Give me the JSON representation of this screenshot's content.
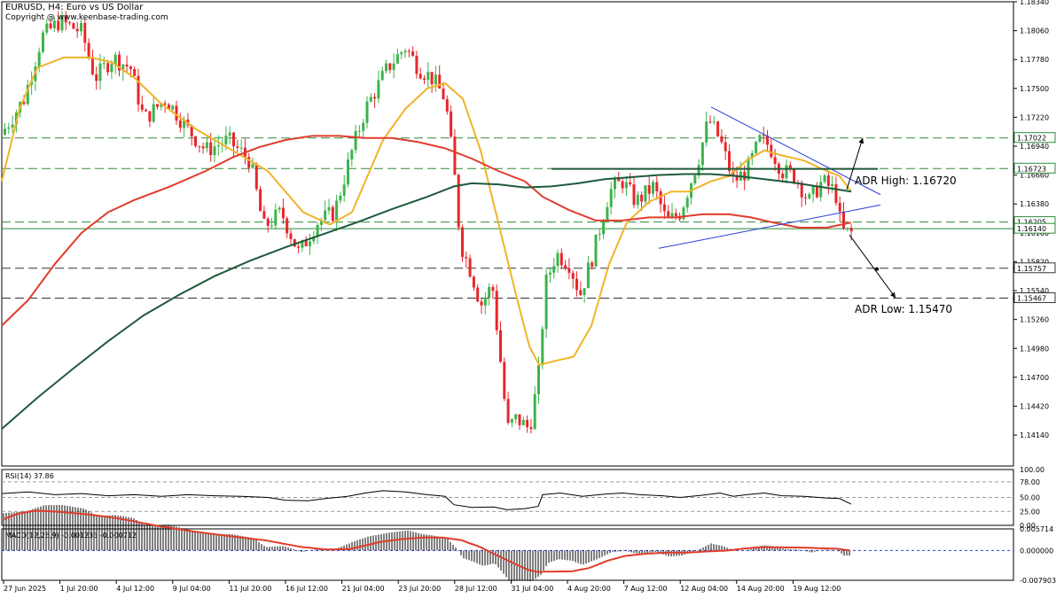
{
  "header": {
    "symbol_line": "EURUSD, H4:  Euro vs US Dollar",
    "copyright": "Copyright @ www.keenbase-trading.com"
  },
  "annotations": {
    "adr_high": "ADR High:  1.16720",
    "adr_low": "ADR Low:  1.15470"
  },
  "chart_data": [
    {
      "type": "candlestick",
      "title": "EURUSD, H4:  Euro vs US Dollar",
      "ylim": [
        1.1384,
        1.1834
      ],
      "y_ticks": [
        "1.18340",
        "1.18060",
        "1.17780",
        "1.17500",
        "1.17220",
        "1.16940",
        "1.16660",
        "1.16380",
        "1.16100",
        "1.15820",
        "1.15540",
        "1.15260",
        "1.14980",
        "1.14700",
        "1.14420",
        "1.14140"
      ],
      "x_ticks": [
        "27 Jun 2025",
        "1 Jul 20:00",
        "4 Jul 12:00",
        "9 Jul 04:00",
        "11 Jul 20:00",
        "16 Jul 12:00",
        "21 Jul 04:00",
        "23 Jul 20:00",
        "28 Jul 12:00",
        "31 Jul 04:00",
        "4 Aug 20:00",
        "7 Aug 12:00",
        "12 Aug 04:00",
        "14 Aug 20:00",
        "19 Aug 12:00"
      ],
      "price_path": [
        [
          0,
          1.17
        ],
        [
          30,
          1.174
        ],
        [
          50,
          1.18
        ],
        [
          70,
          1.1815
        ],
        [
          95,
          1.1805
        ],
        [
          110,
          1.176
        ],
        [
          130,
          1.178
        ],
        [
          150,
          1.177
        ],
        [
          165,
          1.172
        ],
        [
          190,
          1.174
        ],
        [
          215,
          1.171
        ],
        [
          235,
          1.169
        ],
        [
          260,
          1.17
        ],
        [
          285,
          1.168
        ],
        [
          300,
          1.1615
        ],
        [
          320,
          1.163
        ],
        [
          340,
          1.159
        ],
        [
          360,
          1.162
        ],
        [
          380,
          1.163
        ],
        [
          400,
          1.169
        ],
        [
          415,
          1.173
        ],
        [
          440,
          1.177
        ],
        [
          460,
          1.179
        ],
        [
          475,
          1.177
        ],
        [
          490,
          1.176
        ],
        [
          505,
          1.174
        ],
        [
          515,
          1.167
        ],
        [
          522,
          1.16
        ],
        [
          535,
          1.157
        ],
        [
          545,
          1.154
        ],
        [
          558,
          1.156
        ],
        [
          568,
          1.148
        ],
        [
          575,
          1.142
        ],
        [
          585,
          1.143
        ],
        [
          600,
          1.142
        ],
        [
          610,
          1.147
        ],
        [
          618,
          1.156
        ],
        [
          630,
          1.159
        ],
        [
          645,
          1.158
        ],
        [
          657,
          1.155
        ],
        [
          672,
          1.159
        ],
        [
          690,
          1.165
        ],
        [
          705,
          1.166
        ],
        [
          720,
          1.164
        ],
        [
          740,
          1.1655
        ],
        [
          755,
          1.162
        ],
        [
          770,
          1.163
        ],
        [
          790,
          1.168
        ],
        [
          802,
          1.172
        ],
        [
          815,
          1.17
        ],
        [
          830,
          1.166
        ],
        [
          845,
          1.167
        ],
        [
          860,
          1.17
        ],
        [
          870,
          1.1695
        ],
        [
          885,
          1.167
        ],
        [
          900,
          1.1665
        ],
        [
          915,
          1.164
        ],
        [
          930,
          1.166
        ],
        [
          945,
          1.165
        ],
        [
          952,
          1.1612
        ],
        [
          960,
          1.161
        ]
      ],
      "series": [
        {
          "name": "MA fast",
          "color": "#f0b429",
          "values": [
            [
              0,
              1.166
            ],
            [
              20,
              1.173
            ],
            [
              40,
              1.177
            ],
            [
              70,
              1.178
            ],
            [
              100,
              1.178
            ],
            [
              125,
              1.1775
            ],
            [
              150,
              1.176
            ],
            [
              180,
              1.1735
            ],
            [
              220,
              1.171
            ],
            [
              260,
              1.169
            ],
            [
              300,
              1.167
            ],
            [
              320,
              1.165
            ],
            [
              340,
              1.163
            ],
            [
              370,
              1.1618
            ],
            [
              395,
              1.163
            ],
            [
              410,
              1.166
            ],
            [
              430,
              1.17
            ],
            [
              455,
              1.173
            ],
            [
              480,
              1.175
            ],
            [
              500,
              1.1755
            ],
            [
              520,
              1.174
            ],
            [
              540,
              1.169
            ],
            [
              560,
              1.162
            ],
            [
              580,
              1.155
            ],
            [
              595,
              1.15
            ],
            [
              606,
              1.1482
            ],
            [
              625,
              1.1486
            ],
            [
              645,
              1.149
            ],
            [
              665,
              1.152
            ],
            [
              685,
              1.158
            ],
            [
              705,
              1.162
            ],
            [
              730,
              1.164
            ],
            [
              755,
              1.165
            ],
            [
              775,
              1.165
            ],
            [
              800,
              1.166
            ],
            [
              820,
              1.1665
            ],
            [
              840,
              1.168
            ],
            [
              860,
              1.169
            ],
            [
              880,
              1.1685
            ],
            [
              905,
              1.168
            ],
            [
              925,
              1.1672
            ],
            [
              945,
              1.1665
            ],
            [
              958,
              1.165
            ]
          ]
        },
        {
          "name": "MA mid",
          "color": "#e03c2c",
          "values": [
            [
              0,
              1.152
            ],
            [
              30,
              1.1545
            ],
            [
              60,
              1.158
            ],
            [
              90,
              1.161
            ],
            [
              120,
              1.163
            ],
            [
              150,
              1.1642
            ],
            [
              190,
              1.1655
            ],
            [
              230,
              1.167
            ],
            [
              260,
              1.1683
            ],
            [
              290,
              1.1693
            ],
            [
              320,
              1.17
            ],
            [
              350,
              1.1704
            ],
            [
              380,
              1.1704
            ],
            [
              410,
              1.1702
            ],
            [
              440,
              1.1702
            ],
            [
              470,
              1.1698
            ],
            [
              500,
              1.1692
            ],
            [
              530,
              1.1682
            ],
            [
              560,
              1.167
            ],
            [
              590,
              1.166
            ],
            [
              610,
              1.1645
            ],
            [
              640,
              1.1632
            ],
            [
              670,
              1.1622
            ],
            [
              700,
              1.1622
            ],
            [
              730,
              1.1625
            ],
            [
              760,
              1.1625
            ],
            [
              790,
              1.1628
            ],
            [
              820,
              1.1628
            ],
            [
              845,
              1.1625
            ],
            [
              870,
              1.162
            ],
            [
              900,
              1.1615
            ],
            [
              930,
              1.1615
            ],
            [
              958,
              1.162
            ]
          ]
        },
        {
          "name": "MA slow",
          "color": "#1e5a3c",
          "values": [
            [
              0,
              1.142
            ],
            [
              40,
              1.145
            ],
            [
              80,
              1.1478
            ],
            [
              120,
              1.1505
            ],
            [
              160,
              1.153
            ],
            [
              200,
              1.155
            ],
            [
              240,
              1.1568
            ],
            [
              280,
              1.1583
            ],
            [
              320,
              1.1596
            ],
            [
              360,
              1.1608
            ],
            [
              400,
              1.162
            ],
            [
              440,
              1.1633
            ],
            [
              480,
              1.1645
            ],
            [
              510,
              1.1655
            ],
            [
              530,
              1.1658
            ],
            [
              560,
              1.1657
            ],
            [
              590,
              1.1654
            ],
            [
              620,
              1.1655
            ],
            [
              650,
              1.1658
            ],
            [
              680,
              1.1662
            ],
            [
              710,
              1.1664
            ],
            [
              740,
              1.1666
            ],
            [
              770,
              1.1667
            ],
            [
              800,
              1.1667
            ],
            [
              830,
              1.1665
            ],
            [
              860,
              1.1662
            ],
            [
              890,
              1.1659
            ],
            [
              920,
              1.1655
            ],
            [
              958,
              1.165
            ]
          ]
        }
      ],
      "levels": [
        {
          "price": 1.1702,
          "label": "1.17022",
          "style": "dashed",
          "color": "#2e8b3a"
        },
        {
          "price": 1.16723,
          "label": "1.16723",
          "style": "dashed",
          "color": "#2e8b3a"
        },
        {
          "price": 1.16205,
          "label": "1.16205",
          "style": "dashed",
          "color": "#2e8b3a"
        },
        {
          "price": 1.1614,
          "label": "1.16140",
          "style": "solid",
          "color": "#2e8b3a"
        },
        {
          "price": 1.15757,
          "label": "1.15757",
          "style": "dashed",
          "color": "#333333"
        },
        {
          "price": 1.15467,
          "label": "1.15467",
          "style": "dashed",
          "color": "#333333"
        }
      ],
      "trendlines": [
        {
          "from": [
            802,
            1.1732
          ],
          "to": [
            993,
            1.1647
          ],
          "color": "#2b3fd8"
        },
        {
          "from": [
            743,
            1.1595
          ],
          "to": [
            993,
            1.1637
          ],
          "color": "#2b3fd8"
        },
        {
          "from": [
            622,
            1.1672
          ],
          "to": [
            990,
            1.1672
          ],
          "color": "#1e5a3c"
        }
      ]
    },
    {
      "type": "line",
      "title": "RSI(14) 37.86",
      "ylim": [
        0,
        100
      ],
      "y_ticks": [
        "100.00",
        "78.00",
        "50.00",
        "25.00",
        "0.00"
      ],
      "levels": [
        78,
        50,
        25
      ],
      "values": [
        [
          0,
          57
        ],
        [
          30,
          60
        ],
        [
          60,
          55
        ],
        [
          90,
          57
        ],
        [
          120,
          53
        ],
        [
          150,
          55
        ],
        [
          180,
          52
        ],
        [
          210,
          55
        ],
        [
          240,
          53
        ],
        [
          270,
          52
        ],
        [
          300,
          50
        ],
        [
          320,
          45
        ],
        [
          345,
          44
        ],
        [
          365,
          48
        ],
        [
          390,
          52
        ],
        [
          410,
          58
        ],
        [
          430,
          62
        ],
        [
          455,
          60
        ],
        [
          480,
          55
        ],
        [
          500,
          52
        ],
        [
          510,
          37
        ],
        [
          530,
          32
        ],
        [
          555,
          33
        ],
        [
          570,
          28
        ],
        [
          590,
          30
        ],
        [
          605,
          34
        ],
        [
          610,
          55
        ],
        [
          630,
          58
        ],
        [
          655,
          52
        ],
        [
          680,
          56
        ],
        [
          700,
          58
        ],
        [
          720,
          55
        ],
        [
          745,
          53
        ],
        [
          765,
          50
        ],
        [
          790,
          54
        ],
        [
          810,
          58
        ],
        [
          825,
          52
        ],
        [
          840,
          55
        ],
        [
          860,
          58
        ],
        [
          880,
          53
        ],
        [
          905,
          52
        ],
        [
          930,
          49
        ],
        [
          945,
          48
        ],
        [
          958,
          38
        ]
      ]
    },
    {
      "type": "bar",
      "title": "MACD(12,26,9) -0.001233 -0.000712",
      "ylim": [
        -0.007903,
        0.005714
      ],
      "y_ticks": [
        "0.005714",
        "0.000000",
        "-0.007903"
      ],
      "signal_color": "#e03c2c"
    }
  ]
}
